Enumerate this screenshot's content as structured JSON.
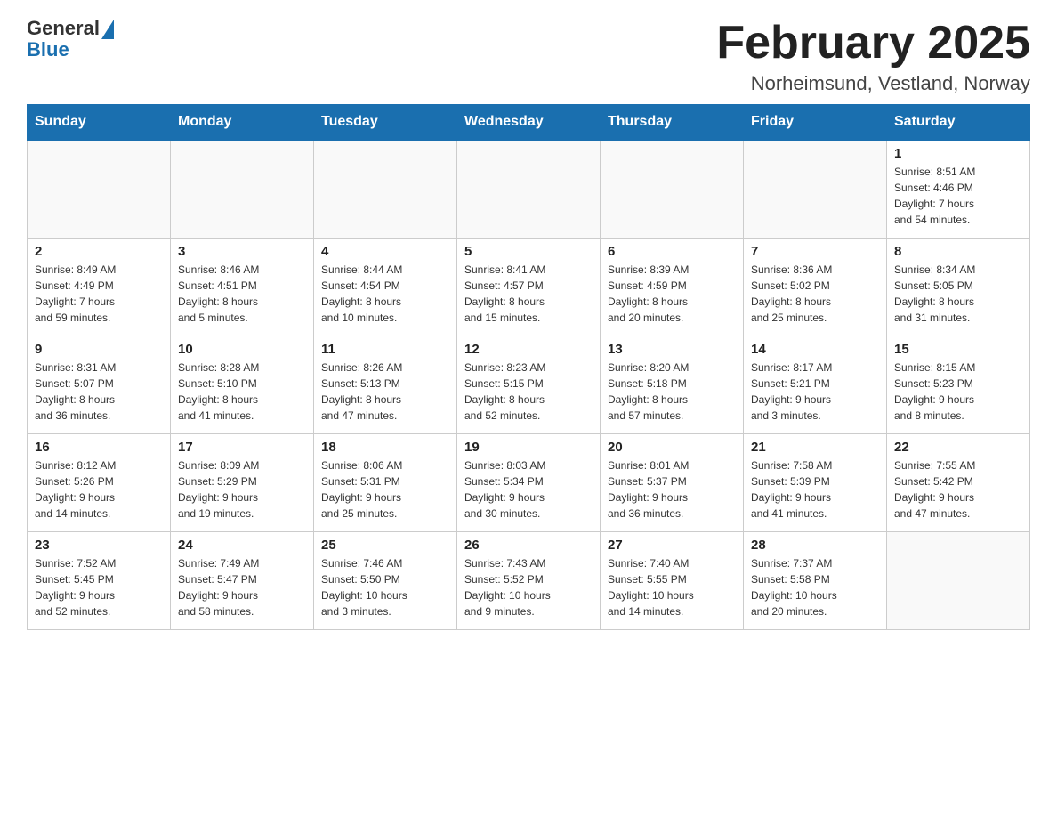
{
  "header": {
    "logo_general": "General",
    "logo_blue": "Blue",
    "month_title": "February 2025",
    "location": "Norheimsund, Vestland, Norway"
  },
  "days_of_week": [
    "Sunday",
    "Monday",
    "Tuesday",
    "Wednesday",
    "Thursday",
    "Friday",
    "Saturday"
  ],
  "weeks": [
    [
      {
        "day": "",
        "info": ""
      },
      {
        "day": "",
        "info": ""
      },
      {
        "day": "",
        "info": ""
      },
      {
        "day": "",
        "info": ""
      },
      {
        "day": "",
        "info": ""
      },
      {
        "day": "",
        "info": ""
      },
      {
        "day": "1",
        "info": "Sunrise: 8:51 AM\nSunset: 4:46 PM\nDaylight: 7 hours\nand 54 minutes."
      }
    ],
    [
      {
        "day": "2",
        "info": "Sunrise: 8:49 AM\nSunset: 4:49 PM\nDaylight: 7 hours\nand 59 minutes."
      },
      {
        "day": "3",
        "info": "Sunrise: 8:46 AM\nSunset: 4:51 PM\nDaylight: 8 hours\nand 5 minutes."
      },
      {
        "day": "4",
        "info": "Sunrise: 8:44 AM\nSunset: 4:54 PM\nDaylight: 8 hours\nand 10 minutes."
      },
      {
        "day": "5",
        "info": "Sunrise: 8:41 AM\nSunset: 4:57 PM\nDaylight: 8 hours\nand 15 minutes."
      },
      {
        "day": "6",
        "info": "Sunrise: 8:39 AM\nSunset: 4:59 PM\nDaylight: 8 hours\nand 20 minutes."
      },
      {
        "day": "7",
        "info": "Sunrise: 8:36 AM\nSunset: 5:02 PM\nDaylight: 8 hours\nand 25 minutes."
      },
      {
        "day": "8",
        "info": "Sunrise: 8:34 AM\nSunset: 5:05 PM\nDaylight: 8 hours\nand 31 minutes."
      }
    ],
    [
      {
        "day": "9",
        "info": "Sunrise: 8:31 AM\nSunset: 5:07 PM\nDaylight: 8 hours\nand 36 minutes."
      },
      {
        "day": "10",
        "info": "Sunrise: 8:28 AM\nSunset: 5:10 PM\nDaylight: 8 hours\nand 41 minutes."
      },
      {
        "day": "11",
        "info": "Sunrise: 8:26 AM\nSunset: 5:13 PM\nDaylight: 8 hours\nand 47 minutes."
      },
      {
        "day": "12",
        "info": "Sunrise: 8:23 AM\nSunset: 5:15 PM\nDaylight: 8 hours\nand 52 minutes."
      },
      {
        "day": "13",
        "info": "Sunrise: 8:20 AM\nSunset: 5:18 PM\nDaylight: 8 hours\nand 57 minutes."
      },
      {
        "day": "14",
        "info": "Sunrise: 8:17 AM\nSunset: 5:21 PM\nDaylight: 9 hours\nand 3 minutes."
      },
      {
        "day": "15",
        "info": "Sunrise: 8:15 AM\nSunset: 5:23 PM\nDaylight: 9 hours\nand 8 minutes."
      }
    ],
    [
      {
        "day": "16",
        "info": "Sunrise: 8:12 AM\nSunset: 5:26 PM\nDaylight: 9 hours\nand 14 minutes."
      },
      {
        "day": "17",
        "info": "Sunrise: 8:09 AM\nSunset: 5:29 PM\nDaylight: 9 hours\nand 19 minutes."
      },
      {
        "day": "18",
        "info": "Sunrise: 8:06 AM\nSunset: 5:31 PM\nDaylight: 9 hours\nand 25 minutes."
      },
      {
        "day": "19",
        "info": "Sunrise: 8:03 AM\nSunset: 5:34 PM\nDaylight: 9 hours\nand 30 minutes."
      },
      {
        "day": "20",
        "info": "Sunrise: 8:01 AM\nSunset: 5:37 PM\nDaylight: 9 hours\nand 36 minutes."
      },
      {
        "day": "21",
        "info": "Sunrise: 7:58 AM\nSunset: 5:39 PM\nDaylight: 9 hours\nand 41 minutes."
      },
      {
        "day": "22",
        "info": "Sunrise: 7:55 AM\nSunset: 5:42 PM\nDaylight: 9 hours\nand 47 minutes."
      }
    ],
    [
      {
        "day": "23",
        "info": "Sunrise: 7:52 AM\nSunset: 5:45 PM\nDaylight: 9 hours\nand 52 minutes."
      },
      {
        "day": "24",
        "info": "Sunrise: 7:49 AM\nSunset: 5:47 PM\nDaylight: 9 hours\nand 58 minutes."
      },
      {
        "day": "25",
        "info": "Sunrise: 7:46 AM\nSunset: 5:50 PM\nDaylight: 10 hours\nand 3 minutes."
      },
      {
        "day": "26",
        "info": "Sunrise: 7:43 AM\nSunset: 5:52 PM\nDaylight: 10 hours\nand 9 minutes."
      },
      {
        "day": "27",
        "info": "Sunrise: 7:40 AM\nSunset: 5:55 PM\nDaylight: 10 hours\nand 14 minutes."
      },
      {
        "day": "28",
        "info": "Sunrise: 7:37 AM\nSunset: 5:58 PM\nDaylight: 10 hours\nand 20 minutes."
      },
      {
        "day": "",
        "info": ""
      }
    ]
  ]
}
